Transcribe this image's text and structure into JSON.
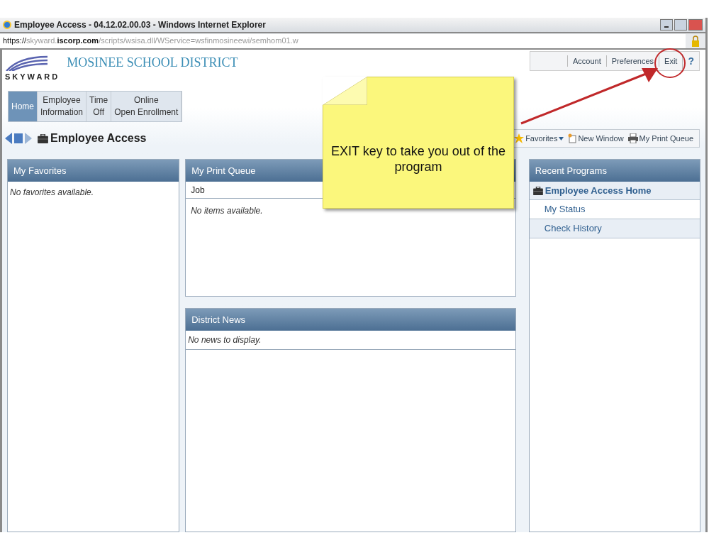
{
  "window": {
    "title": "Employee Access - 04.12.02.00.03 - Windows Internet Explorer"
  },
  "address_bar": {
    "scheme": "https://",
    "host_prefix": "skyward.",
    "host": "iscorp.com",
    "path": "/scripts/wsisa.dll/WService=wsfinmosineewi/semhom01.w"
  },
  "header": {
    "logo_text": "SKYWARD",
    "district": "MOSINEE SCHOOL DISTRICT",
    "links": [
      "Account",
      "Preferences",
      "Exit",
      "?"
    ]
  },
  "nav_tabs": [
    {
      "label": "Home",
      "selected": true
    },
    {
      "label": "Employee\nInformation",
      "selected": false
    },
    {
      "label": "Time\nOff",
      "selected": false
    },
    {
      "label": "Online\nOpen Enrollment",
      "selected": false
    }
  ],
  "page_title": "Employee Access",
  "toolbar": {
    "favorites": "Favorites",
    "new_window": "New Window",
    "print_queue": "My Print Queue"
  },
  "favorites_panel": {
    "title": "My Favorites",
    "empty": "No favorites available."
  },
  "print_queue_panel": {
    "title": "My Print Queue",
    "column": "Job",
    "empty": "No items available."
  },
  "news_panel": {
    "title": "District News",
    "empty": "No news to display."
  },
  "recent_panel": {
    "title": "Recent Programs",
    "items": [
      {
        "label": "Employee Access Home",
        "kind": "header"
      },
      {
        "label": "My Status",
        "kind": "link"
      },
      {
        "label": "Check History",
        "kind": "link"
      }
    ]
  },
  "callout": {
    "text": "EXIT key to take you out of the program"
  }
}
